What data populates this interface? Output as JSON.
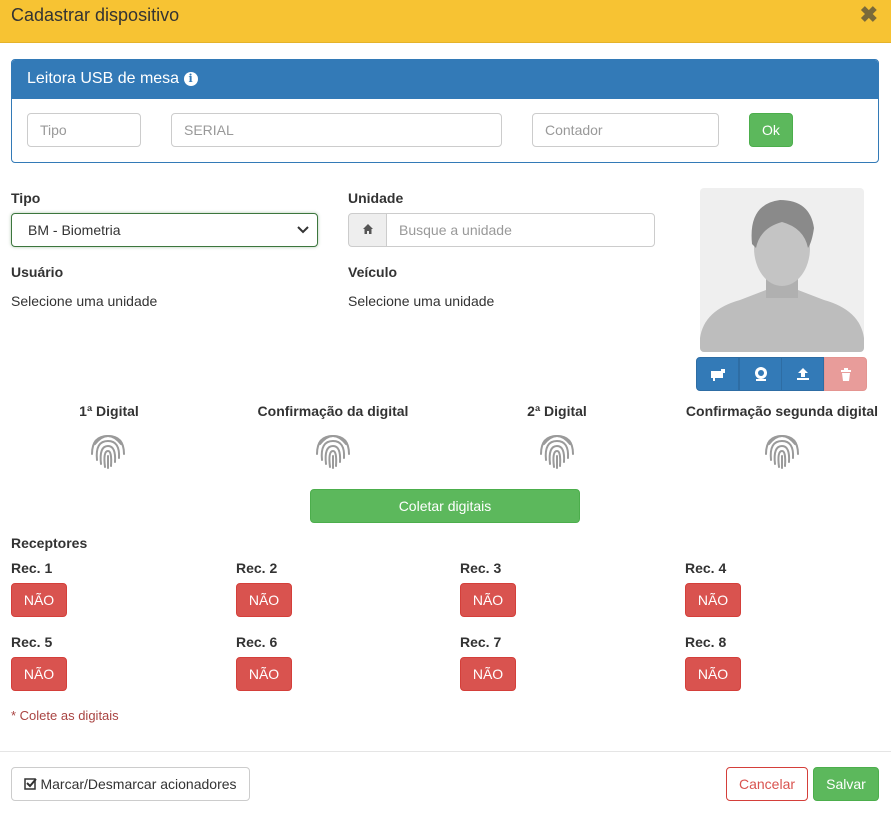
{
  "modal": {
    "title": "Cadastrar dispositivo",
    "close_icon": "✖"
  },
  "usb": {
    "title": "Leitora USB de mesa",
    "tipo_placeholder": "Tipo",
    "serial_placeholder": "SERIAL",
    "contador_placeholder": "Contador",
    "ok_label": "Ok"
  },
  "form": {
    "tipo_label": "Tipo",
    "tipo_value": "BM - Biometria",
    "unidade_label": "Unidade",
    "unidade_placeholder": "Busque a unidade",
    "usuario_label": "Usuário",
    "usuario_value": "Selecione uma unidade",
    "veiculo_label": "Veículo",
    "veiculo_value": "Selecione uma unidade"
  },
  "fingerprints": [
    {
      "label": "1ª Digital"
    },
    {
      "label": "Confirmação da digital"
    },
    {
      "label": "2ª Digital"
    },
    {
      "label": "Confirmação segunda digital"
    }
  ],
  "collect_label": "Coletar digitais",
  "receptores": {
    "title": "Receptores",
    "items": [
      {
        "label": "Rec. 1",
        "value": "NÃO"
      },
      {
        "label": "Rec. 2",
        "value": "NÃO"
      },
      {
        "label": "Rec. 3",
        "value": "NÃO"
      },
      {
        "label": "Rec. 4",
        "value": "NÃO"
      },
      {
        "label": "Rec. 5",
        "value": "NÃO"
      },
      {
        "label": "Rec. 6",
        "value": "NÃO"
      },
      {
        "label": "Rec. 7",
        "value": "NÃO"
      },
      {
        "label": "Rec. 8",
        "value": "NÃO"
      }
    ]
  },
  "note": "* Colete as digitais",
  "footer": {
    "toggle_label": "Marcar/Desmarcar acionadores",
    "cancel_label": "Cancelar",
    "save_label": "Salvar"
  },
  "colors": {
    "header": "#f7c333",
    "primary": "#337ab7",
    "success": "#5cb85c",
    "danger": "#d9534f"
  }
}
